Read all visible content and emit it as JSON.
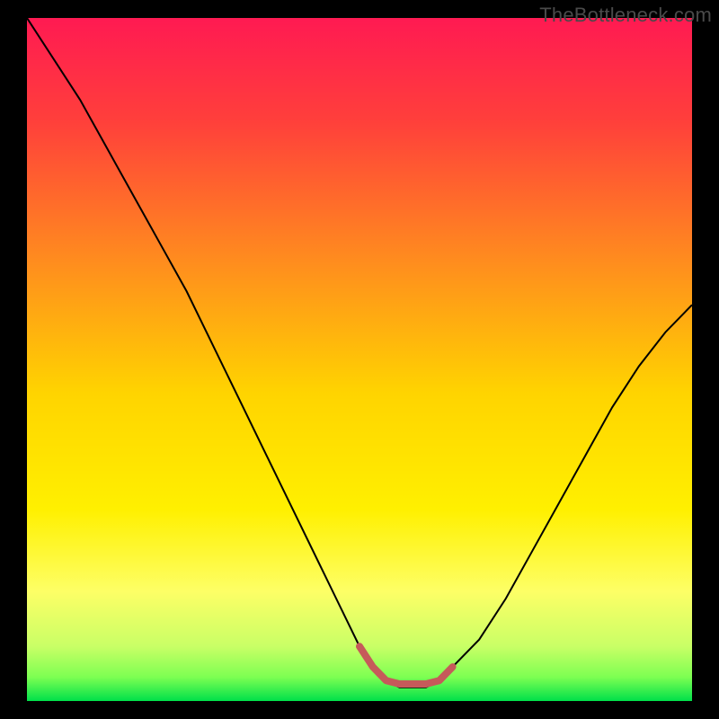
{
  "watermark": "TheBottleneck.com",
  "chart_data": {
    "type": "line",
    "title": "",
    "xlabel": "",
    "ylabel": "",
    "xlim": [
      0,
      100
    ],
    "ylim": [
      0,
      100
    ],
    "background_gradient": {
      "stops": [
        {
          "offset": 0.0,
          "color": "#ff1a52"
        },
        {
          "offset": 0.15,
          "color": "#ff3f3b"
        },
        {
          "offset": 0.35,
          "color": "#ff8a1f"
        },
        {
          "offset": 0.55,
          "color": "#ffd400"
        },
        {
          "offset": 0.72,
          "color": "#fff000"
        },
        {
          "offset": 0.84,
          "color": "#fdff66"
        },
        {
          "offset": 0.92,
          "color": "#c9ff66"
        },
        {
          "offset": 0.965,
          "color": "#7dff52"
        },
        {
          "offset": 1.0,
          "color": "#00e04a"
        }
      ]
    },
    "series": [
      {
        "name": "bottleneck-curve",
        "color": "#000000",
        "width": 2,
        "x": [
          0,
          4,
          8,
          12,
          16,
          20,
          24,
          28,
          32,
          36,
          40,
          44,
          48,
          50,
          52,
          54,
          56,
          58,
          60,
          62,
          64,
          68,
          72,
          76,
          80,
          84,
          88,
          92,
          96,
          100
        ],
        "y": [
          100,
          94,
          88,
          81,
          74,
          67,
          60,
          52,
          44,
          36,
          28,
          20,
          12,
          8,
          5,
          3,
          2,
          2,
          2,
          3,
          5,
          9,
          15,
          22,
          29,
          36,
          43,
          49,
          54,
          58
        ]
      },
      {
        "name": "optimal-band",
        "color": "#c65a5a",
        "width": 8,
        "x": [
          50,
          52,
          54,
          56,
          58,
          60,
          62,
          64
        ],
        "y": [
          8,
          5,
          3,
          2.5,
          2.5,
          2.5,
          3,
          5
        ]
      }
    ]
  }
}
